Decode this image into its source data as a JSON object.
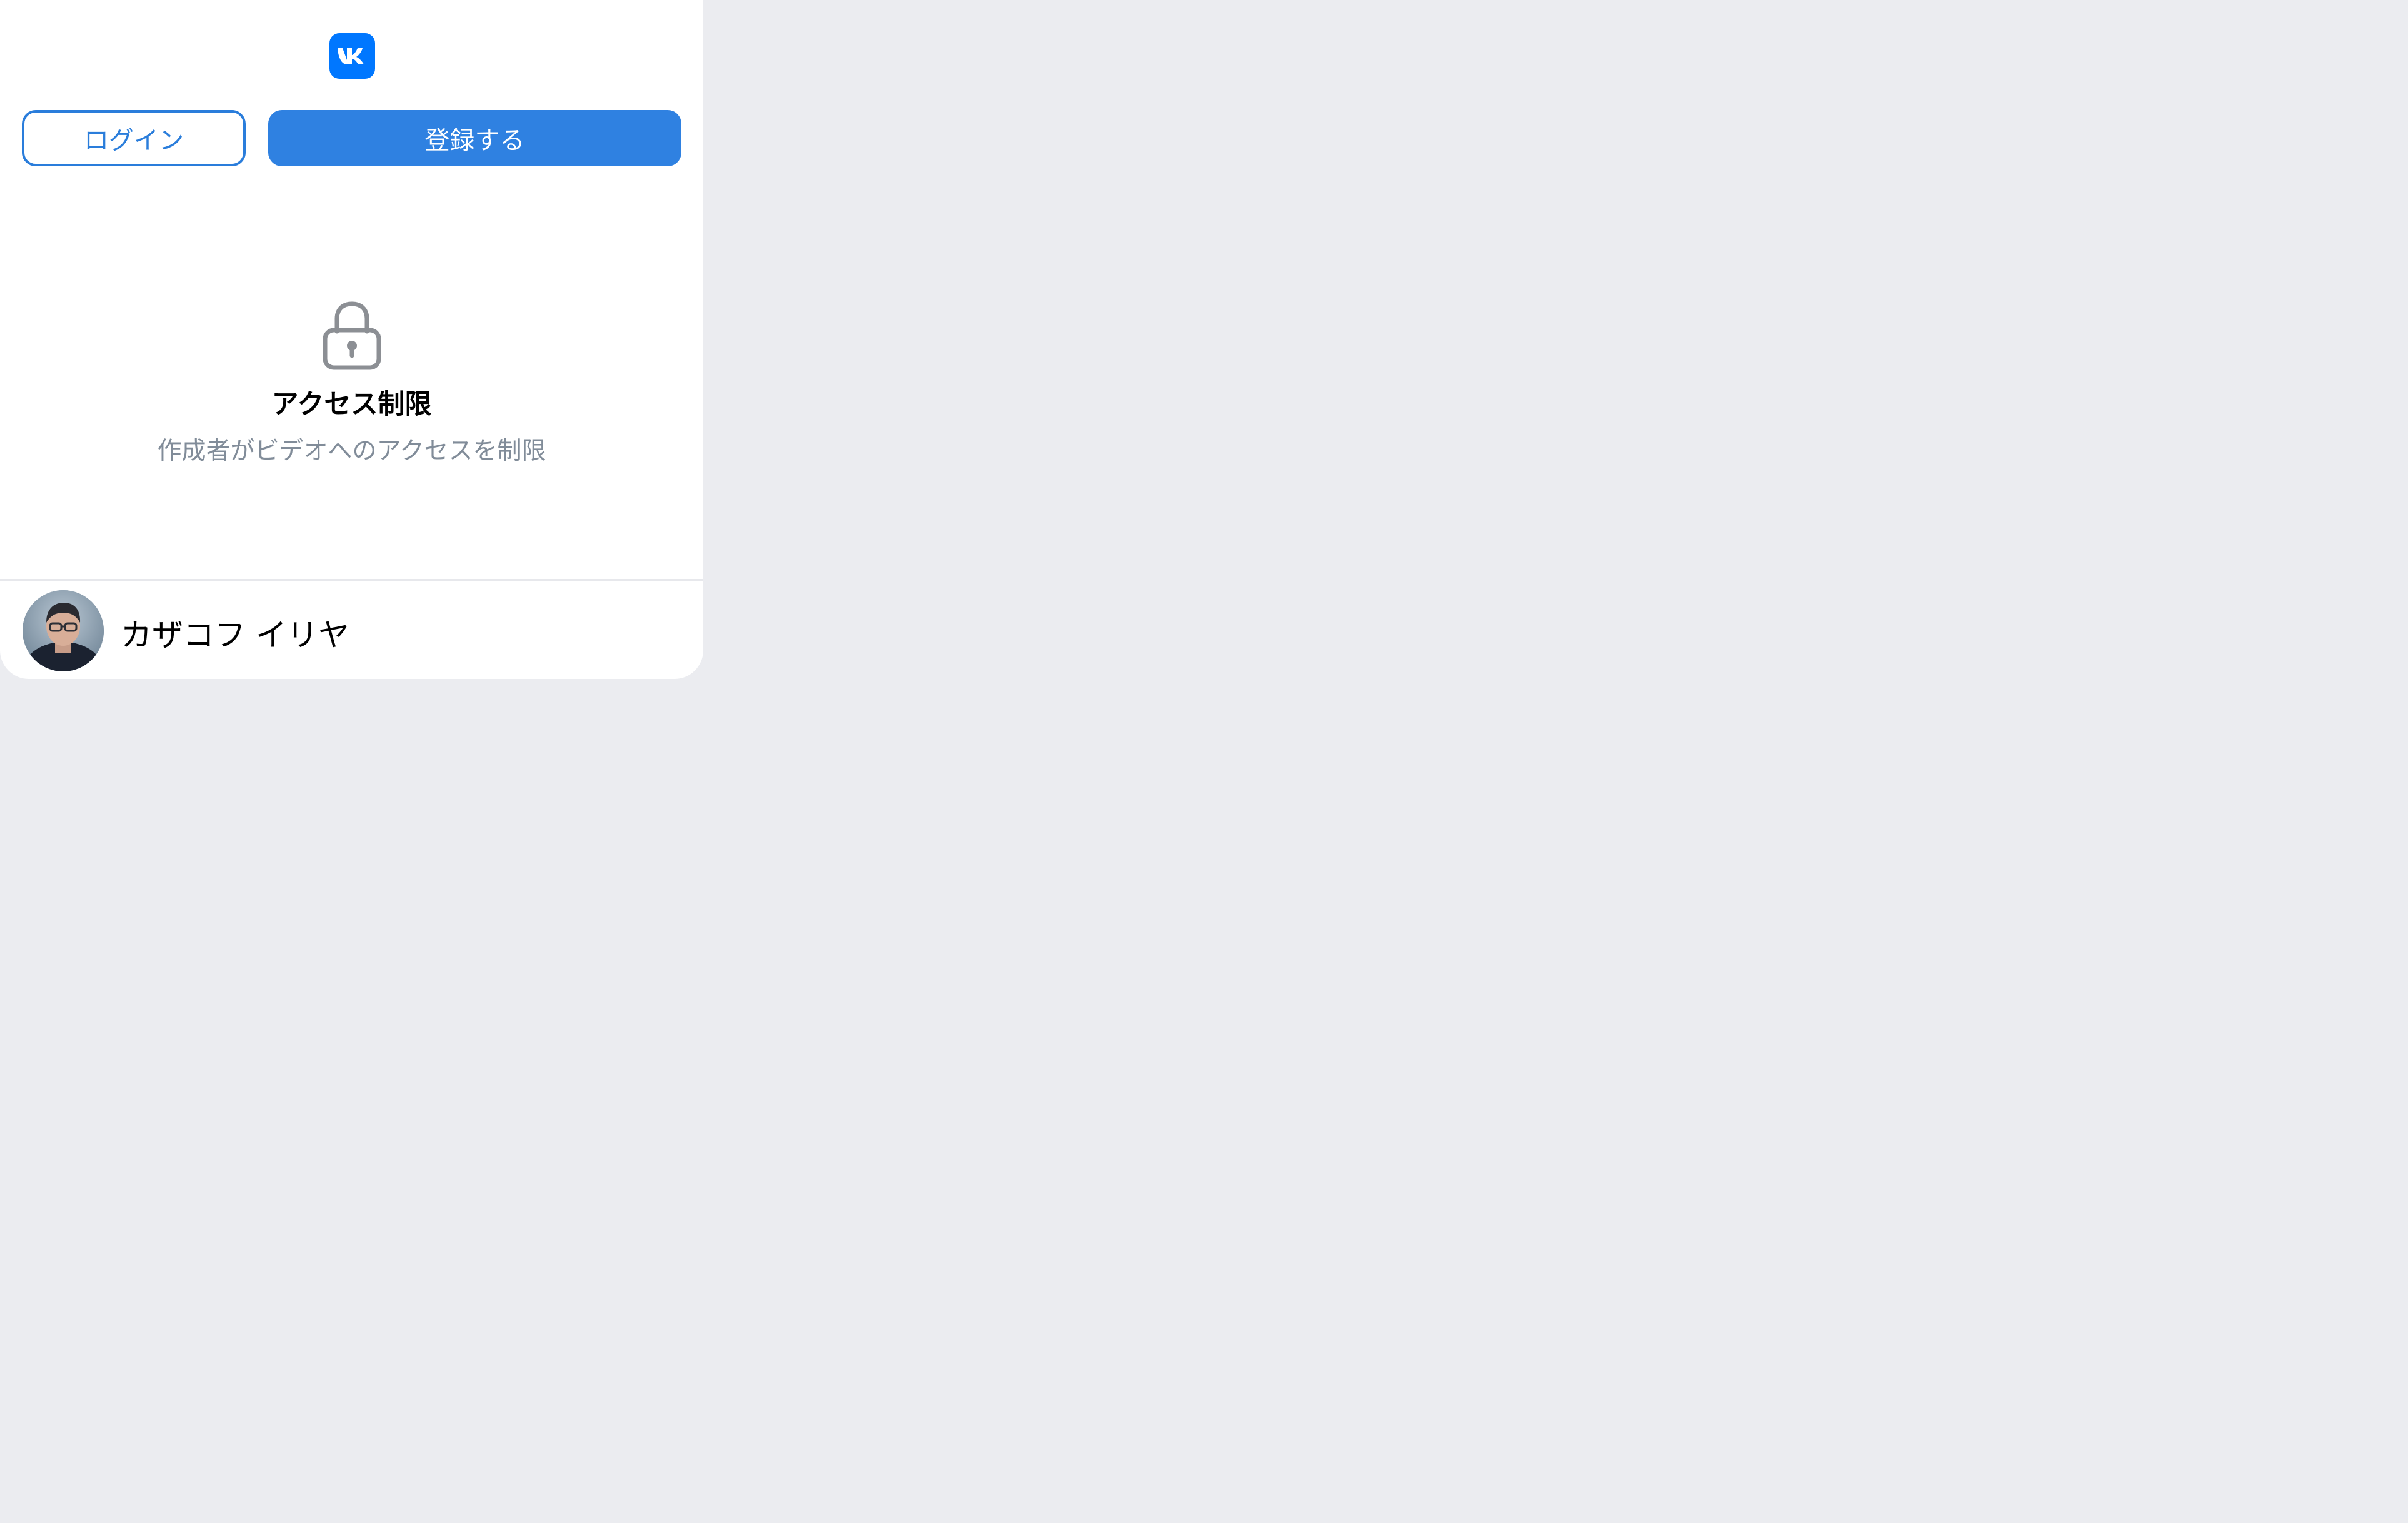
{
  "header": {
    "logo_icon": "vk-logo-icon",
    "brand_color": "#0077ff"
  },
  "auth": {
    "login_label": "ログイン",
    "register_label": "登録する",
    "accent_color": "#2f81e1"
  },
  "restriction": {
    "icon": "lock-icon",
    "title": "アクセス制限",
    "message": "作成者がビデオへのアクセスを制限"
  },
  "author": {
    "name": "カザコフ イリヤ"
  }
}
